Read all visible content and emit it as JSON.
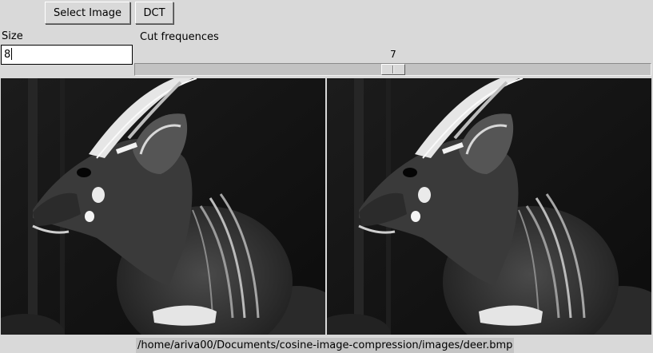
{
  "toolbar": {
    "select_image_label": "Select Image",
    "dct_label": "DCT"
  },
  "size": {
    "label": "Size",
    "value": "8"
  },
  "cut": {
    "label": "Cut frequences",
    "value": "7",
    "slider_fraction": 0.48
  },
  "images": {
    "original_subject": "deer-photo-grayscale",
    "compressed_subject": "deer-photo-grayscale-dct"
  },
  "status": {
    "file_path": "/home/ariva00/Documents/cosine-image-compression/images/deer.bmp"
  }
}
